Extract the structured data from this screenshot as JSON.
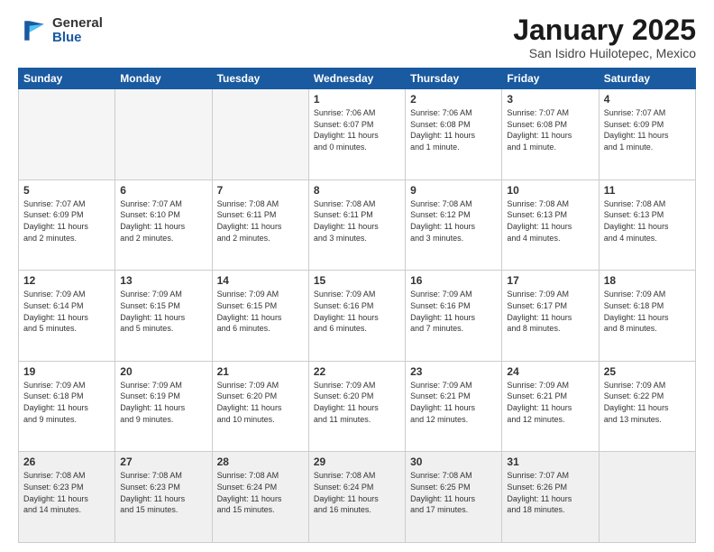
{
  "logo": {
    "general": "General",
    "blue": "Blue"
  },
  "title": "January 2025",
  "location": "San Isidro Huilotepec, Mexico",
  "days_of_week": [
    "Sunday",
    "Monday",
    "Tuesday",
    "Wednesday",
    "Thursday",
    "Friday",
    "Saturday"
  ],
  "weeks": [
    [
      {
        "day": "",
        "info": ""
      },
      {
        "day": "",
        "info": ""
      },
      {
        "day": "",
        "info": ""
      },
      {
        "day": "1",
        "info": "Sunrise: 7:06 AM\nSunset: 6:07 PM\nDaylight: 11 hours\nand 0 minutes."
      },
      {
        "day": "2",
        "info": "Sunrise: 7:06 AM\nSunset: 6:08 PM\nDaylight: 11 hours\nand 1 minute."
      },
      {
        "day": "3",
        "info": "Sunrise: 7:07 AM\nSunset: 6:08 PM\nDaylight: 11 hours\nand 1 minute."
      },
      {
        "day": "4",
        "info": "Sunrise: 7:07 AM\nSunset: 6:09 PM\nDaylight: 11 hours\nand 1 minute."
      }
    ],
    [
      {
        "day": "5",
        "info": "Sunrise: 7:07 AM\nSunset: 6:09 PM\nDaylight: 11 hours\nand 2 minutes."
      },
      {
        "day": "6",
        "info": "Sunrise: 7:07 AM\nSunset: 6:10 PM\nDaylight: 11 hours\nand 2 minutes."
      },
      {
        "day": "7",
        "info": "Sunrise: 7:08 AM\nSunset: 6:11 PM\nDaylight: 11 hours\nand 2 minutes."
      },
      {
        "day": "8",
        "info": "Sunrise: 7:08 AM\nSunset: 6:11 PM\nDaylight: 11 hours\nand 3 minutes."
      },
      {
        "day": "9",
        "info": "Sunrise: 7:08 AM\nSunset: 6:12 PM\nDaylight: 11 hours\nand 3 minutes."
      },
      {
        "day": "10",
        "info": "Sunrise: 7:08 AM\nSunset: 6:13 PM\nDaylight: 11 hours\nand 4 minutes."
      },
      {
        "day": "11",
        "info": "Sunrise: 7:08 AM\nSunset: 6:13 PM\nDaylight: 11 hours\nand 4 minutes."
      }
    ],
    [
      {
        "day": "12",
        "info": "Sunrise: 7:09 AM\nSunset: 6:14 PM\nDaylight: 11 hours\nand 5 minutes."
      },
      {
        "day": "13",
        "info": "Sunrise: 7:09 AM\nSunset: 6:15 PM\nDaylight: 11 hours\nand 5 minutes."
      },
      {
        "day": "14",
        "info": "Sunrise: 7:09 AM\nSunset: 6:15 PM\nDaylight: 11 hours\nand 6 minutes."
      },
      {
        "day": "15",
        "info": "Sunrise: 7:09 AM\nSunset: 6:16 PM\nDaylight: 11 hours\nand 6 minutes."
      },
      {
        "day": "16",
        "info": "Sunrise: 7:09 AM\nSunset: 6:16 PM\nDaylight: 11 hours\nand 7 minutes."
      },
      {
        "day": "17",
        "info": "Sunrise: 7:09 AM\nSunset: 6:17 PM\nDaylight: 11 hours\nand 8 minutes."
      },
      {
        "day": "18",
        "info": "Sunrise: 7:09 AM\nSunset: 6:18 PM\nDaylight: 11 hours\nand 8 minutes."
      }
    ],
    [
      {
        "day": "19",
        "info": "Sunrise: 7:09 AM\nSunset: 6:18 PM\nDaylight: 11 hours\nand 9 minutes."
      },
      {
        "day": "20",
        "info": "Sunrise: 7:09 AM\nSunset: 6:19 PM\nDaylight: 11 hours\nand 9 minutes."
      },
      {
        "day": "21",
        "info": "Sunrise: 7:09 AM\nSunset: 6:20 PM\nDaylight: 11 hours\nand 10 minutes."
      },
      {
        "day": "22",
        "info": "Sunrise: 7:09 AM\nSunset: 6:20 PM\nDaylight: 11 hours\nand 11 minutes."
      },
      {
        "day": "23",
        "info": "Sunrise: 7:09 AM\nSunset: 6:21 PM\nDaylight: 11 hours\nand 12 minutes."
      },
      {
        "day": "24",
        "info": "Sunrise: 7:09 AM\nSunset: 6:21 PM\nDaylight: 11 hours\nand 12 minutes."
      },
      {
        "day": "25",
        "info": "Sunrise: 7:09 AM\nSunset: 6:22 PM\nDaylight: 11 hours\nand 13 minutes."
      }
    ],
    [
      {
        "day": "26",
        "info": "Sunrise: 7:08 AM\nSunset: 6:23 PM\nDaylight: 11 hours\nand 14 minutes."
      },
      {
        "day": "27",
        "info": "Sunrise: 7:08 AM\nSunset: 6:23 PM\nDaylight: 11 hours\nand 15 minutes."
      },
      {
        "day": "28",
        "info": "Sunrise: 7:08 AM\nSunset: 6:24 PM\nDaylight: 11 hours\nand 15 minutes."
      },
      {
        "day": "29",
        "info": "Sunrise: 7:08 AM\nSunset: 6:24 PM\nDaylight: 11 hours\nand 16 minutes."
      },
      {
        "day": "30",
        "info": "Sunrise: 7:08 AM\nSunset: 6:25 PM\nDaylight: 11 hours\nand 17 minutes."
      },
      {
        "day": "31",
        "info": "Sunrise: 7:07 AM\nSunset: 6:26 PM\nDaylight: 11 hours\nand 18 minutes."
      },
      {
        "day": "",
        "info": ""
      }
    ]
  ]
}
